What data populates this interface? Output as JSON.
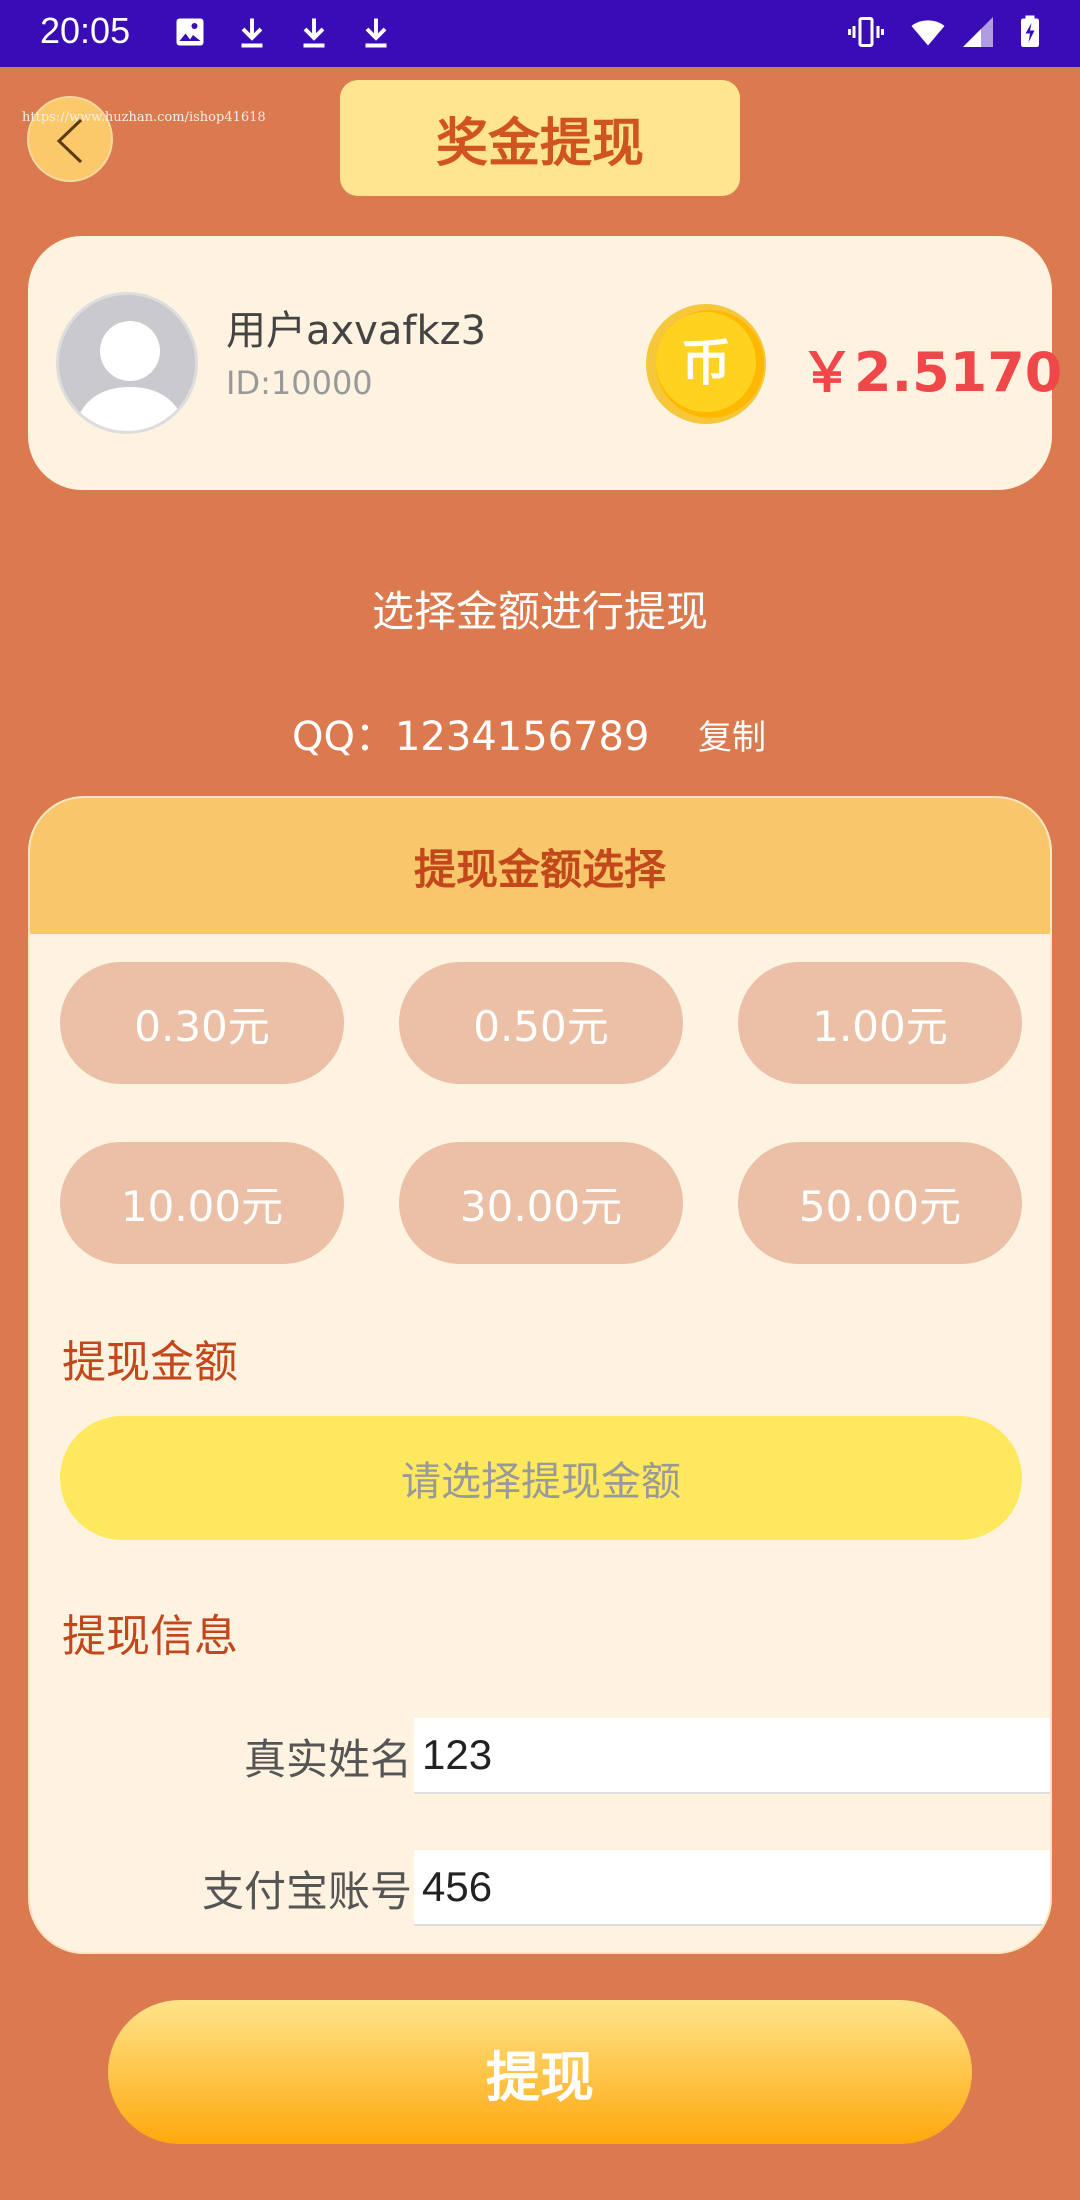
{
  "status_bar": {
    "time": "20:05",
    "icons": [
      "image-icon",
      "download-icon",
      "download-icon",
      "download-icon",
      "vibrate-icon",
      "wifi-icon",
      "signal-icon",
      "battery-charging-icon"
    ]
  },
  "header": {
    "title": "奖金提现",
    "watermark": "https://www.huzhan.com/ishop41618"
  },
  "user": {
    "name": "用户axvafkz3",
    "id": "ID:10000",
    "coin_icon_text": "币",
    "balance": "￥2.5170"
  },
  "prompt": "选择金额进行提现",
  "contact": {
    "qq": "QQ：1234156789",
    "copy_label": "复制"
  },
  "panel": {
    "title": "提现金额选择",
    "amounts": [
      "0.30元",
      "0.50元",
      "1.00元",
      "10.00元",
      "30.00元",
      "50.00元"
    ],
    "amount_label": "提现金额",
    "amount_placeholder": "请选择提现金额",
    "info_label": "提现信息",
    "name_label": "真实姓名",
    "name_value": "123",
    "alipay_label": "支付宝账号",
    "alipay_value": "456"
  },
  "submit_label": "提现",
  "colors": {
    "background": "#DB7A4E",
    "status_bar": "#3A0CB5",
    "accent_red": "#F0484A",
    "label_orange": "#C2481C"
  }
}
